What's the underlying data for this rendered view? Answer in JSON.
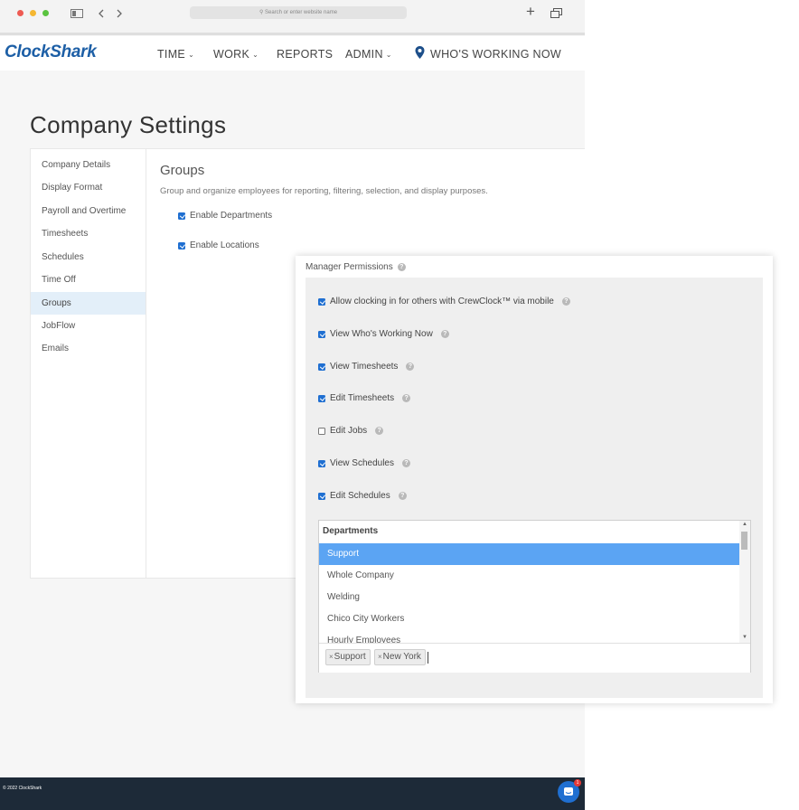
{
  "browser": {
    "address_placeholder": "Search or enter website name",
    "new_tab_label": "+",
    "colors": {
      "close": "#ee5a52",
      "minimize": "#f5b731",
      "zoom": "#5ac33f"
    }
  },
  "navbar": {
    "logo": "ClockShark",
    "items": [
      {
        "label": "TIME",
        "has_caret": true
      },
      {
        "label": "WORK",
        "has_caret": true
      },
      {
        "label": "REPORTS",
        "has_caret": false
      },
      {
        "label": "ADMIN",
        "has_caret": true
      },
      {
        "label": "WHO'S WORKING NOW",
        "has_caret": false
      }
    ]
  },
  "page": {
    "title": "Company Settings"
  },
  "sidebar": {
    "items": [
      {
        "label": "Company Details"
      },
      {
        "label": "Display Format"
      },
      {
        "label": "Payroll and Overtime"
      },
      {
        "label": "Timesheets"
      },
      {
        "label": "Schedules"
      },
      {
        "label": "Time Off"
      },
      {
        "label": "Groups",
        "active": true
      },
      {
        "label": "JobFlow"
      },
      {
        "label": "Emails"
      }
    ]
  },
  "groups": {
    "title": "Groups",
    "description": "Group and organize employees for reporting, filtering, selection, and display purposes.",
    "options": [
      {
        "label": "Enable Departments",
        "checked": true
      },
      {
        "label": "Enable Locations",
        "checked": true
      }
    ]
  },
  "manager_permissions": {
    "label": "Manager Permissions",
    "permissions": [
      {
        "label": "Allow clocking in for others with CrewClock™ via mobile",
        "checked": true
      },
      {
        "label": "View Who's Working Now",
        "checked": true
      },
      {
        "label": "View Timesheets",
        "checked": true
      },
      {
        "label": "Edit Timesheets",
        "checked": true
      },
      {
        "label": "Edit Jobs",
        "checked": false
      },
      {
        "label": "View Schedules",
        "checked": true
      },
      {
        "label": "Edit Schedules",
        "checked": true
      }
    ],
    "departments": {
      "header": "Departments",
      "options": [
        {
          "label": "Support",
          "selected": true
        },
        {
          "label": "Whole Company",
          "selected": false
        },
        {
          "label": "Welding",
          "selected": false
        },
        {
          "label": "Chico City Workers",
          "selected": false
        },
        {
          "label": "Hourly Employees",
          "selected": false
        }
      ],
      "tags": [
        {
          "label": "Support"
        },
        {
          "label": "New York"
        }
      ]
    }
  },
  "footer": {
    "copyright": "© 2022 ClockShark",
    "chat_badge_count": "1"
  }
}
